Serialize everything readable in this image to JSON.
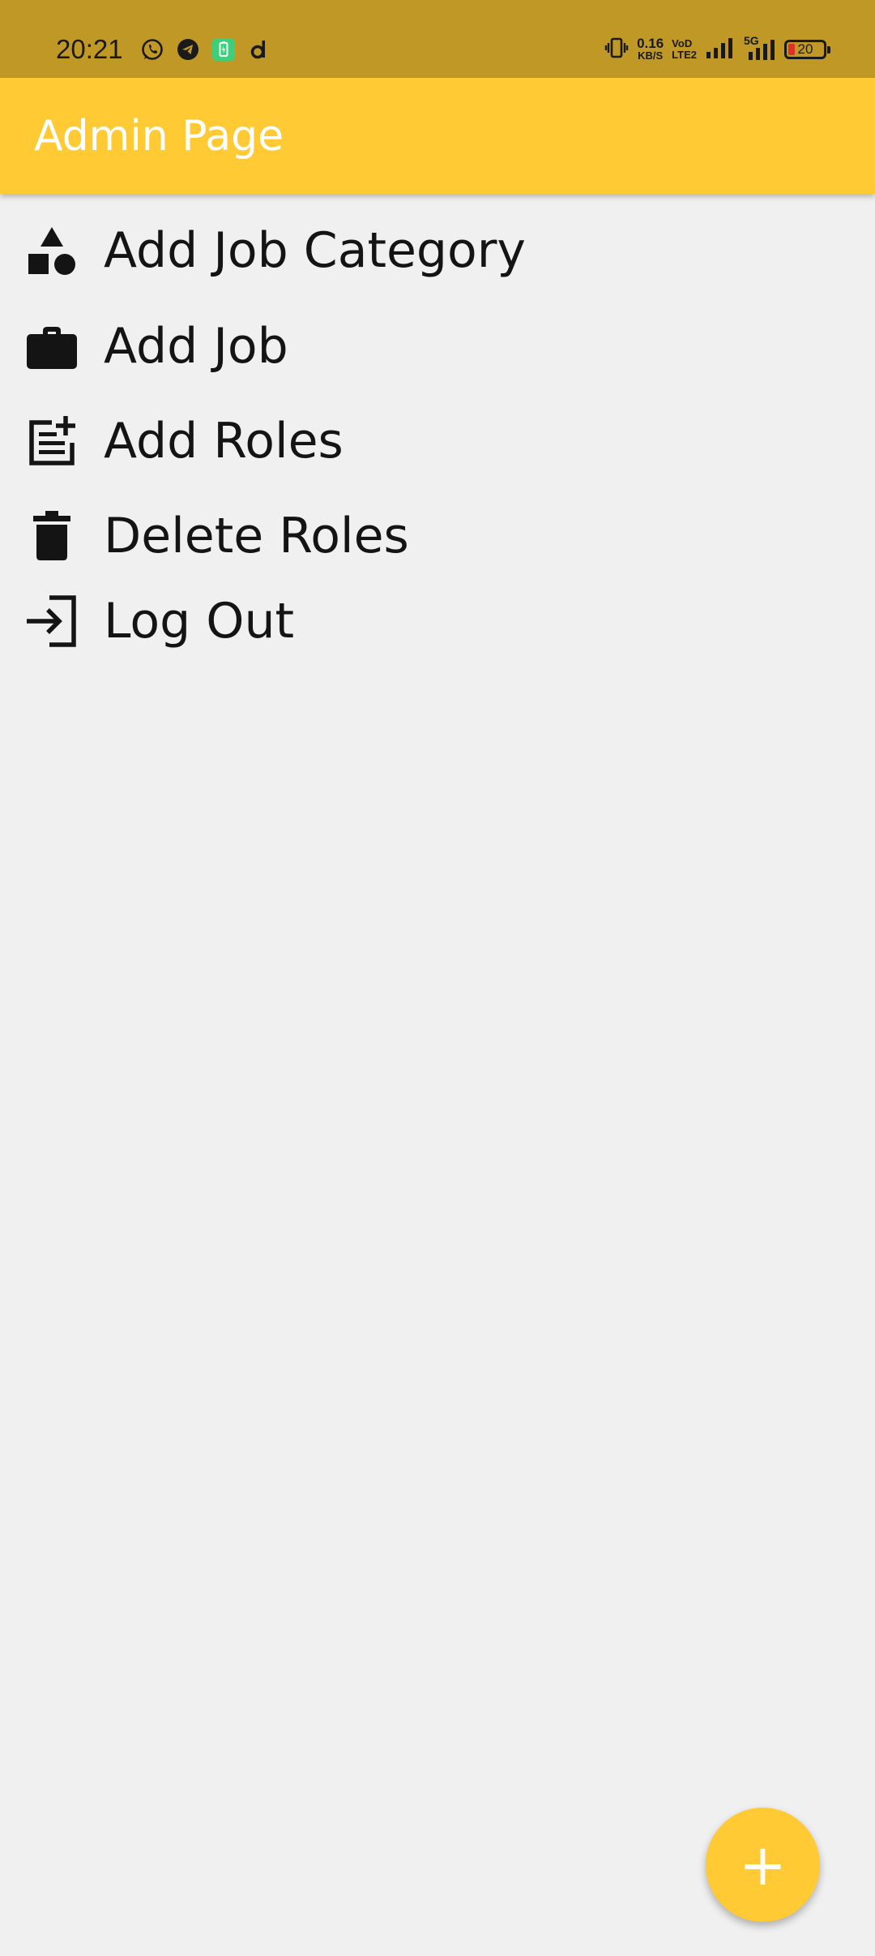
{
  "status_bar": {
    "time": "20:21",
    "left_icons": [
      "whatsapp-icon",
      "telegram-icon",
      "battery-saver-icon",
      "d-app-icon"
    ],
    "net_speed_value": "0.16",
    "net_speed_unit": "KB/S",
    "volte_top": "VoD",
    "volte_bottom": "LTE2",
    "network_type": "5G",
    "battery_level": "20"
  },
  "app_bar": {
    "title": "Admin Page"
  },
  "menu": {
    "items": [
      {
        "label": "Add Job Category",
        "icon": "category-shapes-icon"
      },
      {
        "label": "Add Job",
        "icon": "briefcase-icon"
      },
      {
        "label": "Add Roles",
        "icon": "post-add-icon"
      },
      {
        "label": "Delete Roles",
        "icon": "trash-icon"
      },
      {
        "label": "Log Out",
        "icon": "login-icon"
      }
    ]
  },
  "fab": {
    "label": "+",
    "icon": "add-icon"
  },
  "colors": {
    "status_bar": "#bf9826",
    "app_bar": "#ffca33",
    "background": "#f0f0f0",
    "text": "#141414",
    "fab": "#ffca33"
  }
}
